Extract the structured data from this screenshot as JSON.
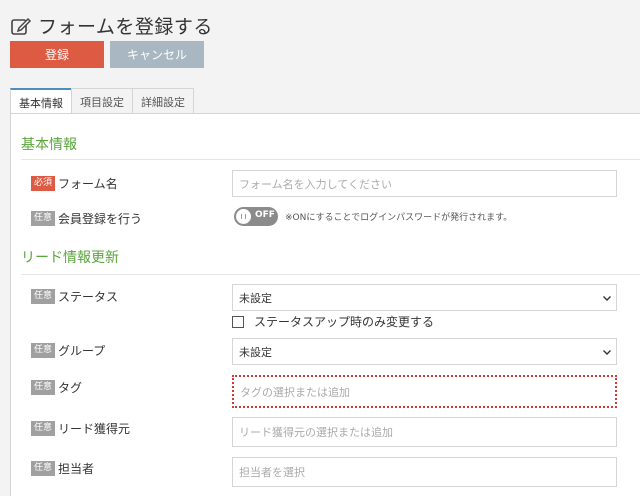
{
  "header": {
    "title": "フォームを登録する",
    "title_icon": "edit-icon",
    "register_label": "登録",
    "cancel_label": "キャンセル"
  },
  "tabs": [
    {
      "label": "基本情報",
      "active": true
    },
    {
      "label": "項目設定",
      "active": false
    },
    {
      "label": "詳細設定",
      "active": false
    }
  ],
  "sections": {
    "basic_title": "基本情報",
    "lead_title": "リード情報更新"
  },
  "badges": {
    "required": "必須",
    "optional": "任意"
  },
  "fields": {
    "form_name": {
      "label": "フォーム名",
      "placeholder": "フォーム名を入力してください"
    },
    "member_registration": {
      "label": "会員登録を行う",
      "toggle_state": "OFF",
      "note": "※ONにすることでログインパスワードが発行されます。"
    },
    "status": {
      "label": "ステータス",
      "value": "未設定",
      "checkbox_label": "ステータスアップ時のみ変更する"
    },
    "group": {
      "label": "グループ",
      "value": "未設定"
    },
    "tag": {
      "label": "タグ",
      "placeholder": "タグの選択または追加"
    },
    "lead_source": {
      "label": "リード獲得元",
      "placeholder": "リード獲得元の選択または追加"
    },
    "owner": {
      "label": "担当者",
      "placeholder": "担当者を選択"
    }
  },
  "colors": {
    "register_button": "#dd5a43",
    "cancel_button": "#a8b7c2",
    "section_title": "#5aa43c",
    "required_badge": "#dd5a43",
    "optional_badge": "#a0a0a0",
    "active_tab_border": "#4c8fbd"
  }
}
